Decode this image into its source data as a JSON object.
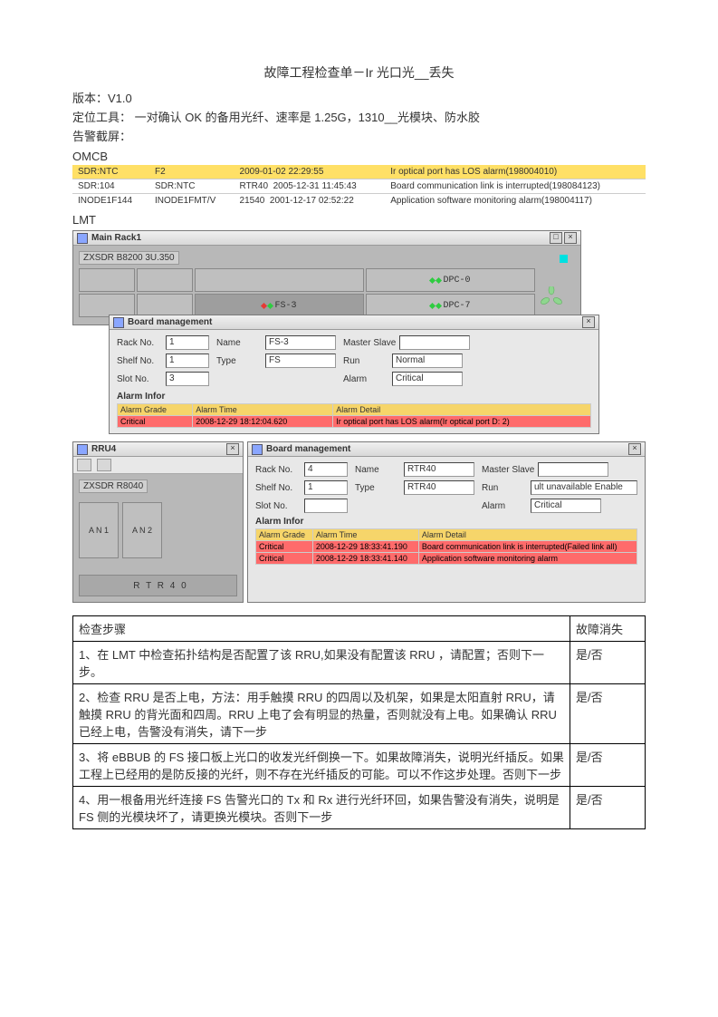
{
  "title": "故障工程检查单－Ir 光口光__丢失",
  "version_label": "版本：",
  "version": "V1.0",
  "tool_label": "定位工具：",
  "tool": " 一对确认 OK 的备用光纤、速率是 1.25G，1310__光模块、防水胶",
  "screenshot_label": "告警截屏：",
  "omcb_label": "OMCB",
  "omcb_header": [
    "SDR:NTC",
    "F2",
    "2009-01-02 22:29:55",
    "Ir optical port has LOS alarm(198004010)"
  ],
  "omcb_rows": [
    [
      "SDR:104",
      "SDR:NTC",
      "RTR40",
      "2005-12-31 11:45:43",
      "Board communication link is interrupted(198084123)"
    ],
    [
      "INODE1F144",
      "INODE1FMT/V",
      "21540",
      "2001-12-17 02:52:22",
      "Application software monitoring alarm(198004117)"
    ]
  ],
  "lmt_label": "LMT",
  "main_rack_title": "Main Rack1",
  "rack_model": "ZXSDR B8200 3U.350",
  "slot_fs": "FS-3",
  "slot_dpc0": "DPC-0",
  "slot_dpc7": "DPC-7",
  "bm_title": "Board management",
  "bm_fields": {
    "rack_no_label": "Rack No.",
    "rack_no": "1",
    "shelf_no_label": "Shelf No.",
    "shelf_no": "1",
    "slot_no_label": "Slot No.",
    "slot_no": "3",
    "name_label": "Name",
    "name": "FS-3",
    "type_label": "Type",
    "type": "FS",
    "master_label": "Master Slave",
    "master": "",
    "run_label": "Run",
    "run": "Normal",
    "alarm_label": "Alarm",
    "alarm": "Critical"
  },
  "alarm_infor_label": "Alarm Infor",
  "alarm_cols": [
    "Alarm Grade",
    "Alarm Time",
    "Alarm Detail"
  ],
  "alarm_row1": [
    "Critical",
    "2008-12-29 18:12:04.620",
    "Ir optical port has LOS alarm(Ir optical port D: 2)"
  ],
  "rru_title": "RRU4",
  "rru_model": "ZXSDR R8040",
  "rru_a1": "A N 1",
  "rru_a2": "A N 2",
  "rtr_label": "R T R 4 0",
  "bm2_title": "Board management",
  "bm2_fields": {
    "rack_no_label": "Rack No.",
    "rack_no": "4",
    "shelf_no_label": "Shelf No.",
    "shelf_no": "1",
    "slot_no_label": "Slot No.",
    "slot_no": "",
    "name_label": "Name",
    "name": "RTR40",
    "type_label": "Type",
    "type": "RTR40",
    "master_label": "Master Slave",
    "master": "",
    "run_label": "Run",
    "run": "ult unavailable Enable",
    "alarm_label": "Alarm",
    "alarm": "Critical"
  },
  "alarm2_rows": [
    [
      "Critical",
      "2008-12-29 18:33:41.190",
      "Board communication link is interrupted(Failed link all)"
    ],
    [
      "Critical",
      "2008-12-29 18:33:41.140",
      "Application software monitoring alarm"
    ]
  ],
  "check_headers": [
    "检查步骤",
    "故障消失"
  ],
  "check_rows": [
    [
      "1、在 LMT 中检查拓扑结构是否配置了该 RRU,如果没有配置该 RRU ，请配置；否则下一步。",
      "是/否"
    ],
    [
      "2、检查 RRU 是否上电，方法：用手触摸 RRU 的四周以及机架，如果是太阳直射 RRU，请触摸 RRU 的背光面和四周。RRU 上电了会有明显的热量，否则就没有上电。如果确认 RRU 已经上电，告警没有消失，请下一步",
      "是/否"
    ],
    [
      "3、将 eBBUB 的 FS 接口板上光口的收发光纤倒换一下。如果故障消失，说明光纤插反。如果工程上已经用的是防反接的光纤，则不存在光纤插反的可能。可以不作这步处理。否则下一步",
      "是/否"
    ],
    [
      "4、用一根备用光纤连接 FS 告警光口的 Tx 和 Rx 进行光纤环回，如果告警没有消失，说明是 FS 侧的光模块坏了，请更换光模块。否则下一步",
      "是/否"
    ]
  ]
}
